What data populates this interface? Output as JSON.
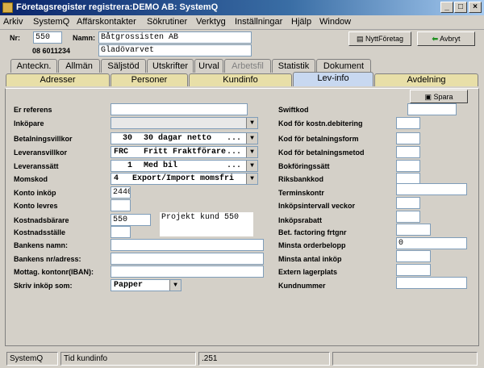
{
  "window": {
    "title": "Företagsregister registrera:DEMO AB: SystemQ"
  },
  "menu": [
    "Arkiv",
    "SystemQ",
    "Affärskontakter",
    "Sökrutiner",
    "Verktyg",
    "Inställningar",
    "Hjälp",
    "Window"
  ],
  "header": {
    "nr_label": "Nr:",
    "nr_value": "550",
    "namn_label": "Namn:",
    "namn_value": "Båtgrossisten AB",
    "phone": "08 6011234",
    "namn2_value": "Gladövarvet",
    "new_company_label": "NyttFöretag",
    "cancel_label": "Avbryt"
  },
  "tabs_row1": [
    "Anteckn.",
    "Allmän",
    "Säljstöd",
    "Utskrifter",
    "Urval",
    "Arbetsfil",
    "Statistik",
    "Dokument"
  ],
  "tabs_row2": [
    "Adresser",
    "Personer",
    "Kundinfo",
    "Lev-info",
    "Avdelning"
  ],
  "save_label": "Spara",
  "left": {
    "er_referens": "Er referens",
    "inkopare": "Inköpare",
    "betalningsvillkor": "Betalningsvillkor",
    "bet_code": "30",
    "bet_text": "30 dagar netto",
    "leveransvillkor": "Leveransvillkor",
    "lev_code": "FRC",
    "lev_text": "Fritt Fraktförare",
    "leveranssatt": "Leveranssätt",
    "ls_code": "1",
    "ls_text": "Med bil",
    "momskod": "Momskod",
    "moms_code": "4",
    "moms_text": "Export/Import momsfri",
    "konto_inkop": "Konto inköp",
    "konto_inkop_value": "2440",
    "konto_levres": "Konto levres",
    "kostnadsbarare": "Kostnadsbärare",
    "kostnadsbarare_value": "550",
    "projekt_text": "Projekt kund 550",
    "kostnadsstalle": "Kostnadsställe",
    "bankens_namn": "Bankens namn:",
    "bankens_nr": "Bankens nr/adress:",
    "mottag": "Mottag. kontonr(IBAN):",
    "skriv": "Skriv inköp som:",
    "skriv_value": "Papper",
    "dots": "..."
  },
  "right": {
    "swiftkod": "Swiftkod",
    "kod_debitering": "Kod för kostn.debitering",
    "kod_betform": "Kod för betalningsform",
    "kod_betmetod": "Kod för betalningsmetod",
    "bokforingssatt": "Bokföringssätt",
    "riksbankkod": "Riksbankkod",
    "terminskontr": "Terminskontr",
    "inkopsintervall": "Inköpsintervall veckor",
    "inkopsrabatt": "Inköpsrabatt",
    "bet_factoring": "Bet. factoring frtgnr",
    "minsta_order": "Minsta orderbelopp",
    "minsta_order_value": "0",
    "minsta_antal": "Minsta antal inköp",
    "extern_lager": "Extern lagerplats",
    "kundnummer": "Kundnummer"
  },
  "status": [
    "SystemQ",
    "Tid kundinfo",
    ".251",
    "",
    ""
  ]
}
